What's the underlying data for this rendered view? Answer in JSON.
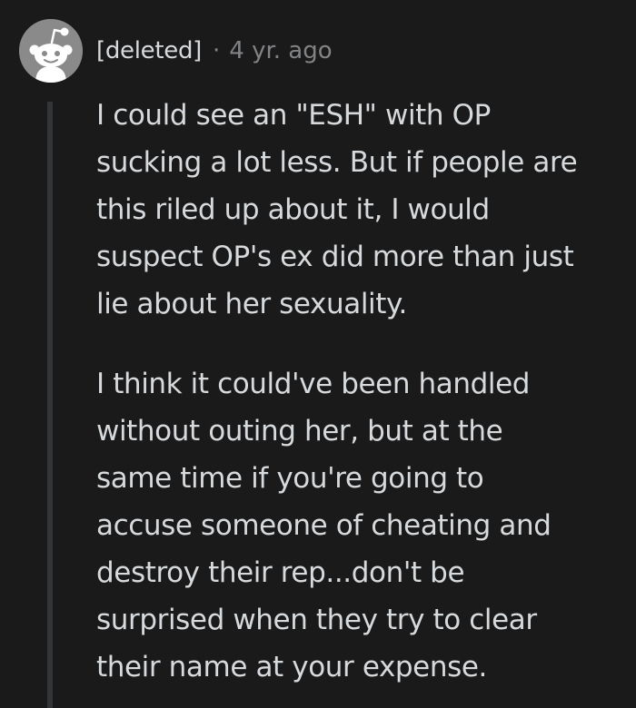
{
  "comment": {
    "author": "[deleted]",
    "separator": "·",
    "timestamp": "4 yr. ago",
    "avatar_icon": "reddit-snoo-icon",
    "paragraphs": [
      "I could see an \"ESH\" with OP\nsucking a lot less. But if people are\nthis riled up about it, I would\nsuspect OP's ex did more than just\nlie about her sexuality.",
      "I think it could've been handled\nwithout outing her, but at the\nsame time if you're going to\naccuse someone of cheating and\ndestroy their rep...don't be\nsurprised when they try to clear\ntheir name at your expense."
    ]
  },
  "colors": {
    "background": "#1a1a1b",
    "text": "#d7dadc",
    "meta": "#818384",
    "thread_line": "#343536",
    "avatar_bg": "#8a8a8a"
  }
}
